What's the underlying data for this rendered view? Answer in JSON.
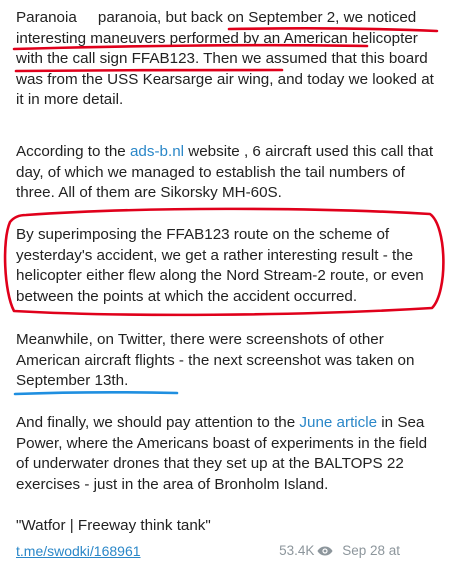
{
  "post": {
    "p1": {
      "a": "Paranoia",
      "b": "paranoia, but back",
      "c": "on September 2, we noticed interesting maneuvers performed by an American helicopter with the call sign FFAB123",
      "d": ". Then we assumed that this board was from the USS Kearsarge air wing, and today we looked at it in more detail."
    },
    "p2": {
      "a": "According to the ",
      "link": "ads-b.nl",
      "b": " website , 6 aircraft used this call that day, of which we managed to establish the tail numbers of three. All of them are Sikorsky MH-60S."
    },
    "p3": "By superimposing the FFAB123 route on the scheme of yesterday's accident, we get a rather interesting result - the helicopter either flew along the Nord Stream-2 route, or even between the points at which the accident occurred.",
    "p4": {
      "a": "Meanwhile, on Twitter, there were screenshots of other American aircraft flights - the next screenshot was taken ",
      "b": "on September 13th."
    },
    "p5": {
      "a": "And finally, we should pay attention to the ",
      "link": "June article",
      "b": " in Sea Power, where the Americans boast of experiments in the field of underwater drones that they set up at the BALTOPS 22 exercises - just in the area of Bronholm Island."
    },
    "signature": "\"Watfor | Freeway think tank\""
  },
  "footer": {
    "link": "t.me/swodki/168961",
    "views": "53.4K",
    "date": "Sep 28 at"
  },
  "colors": {
    "link": "#2a87c8",
    "red_annotation": "#e0001b",
    "blue_annotation": "#1f8fe0"
  }
}
